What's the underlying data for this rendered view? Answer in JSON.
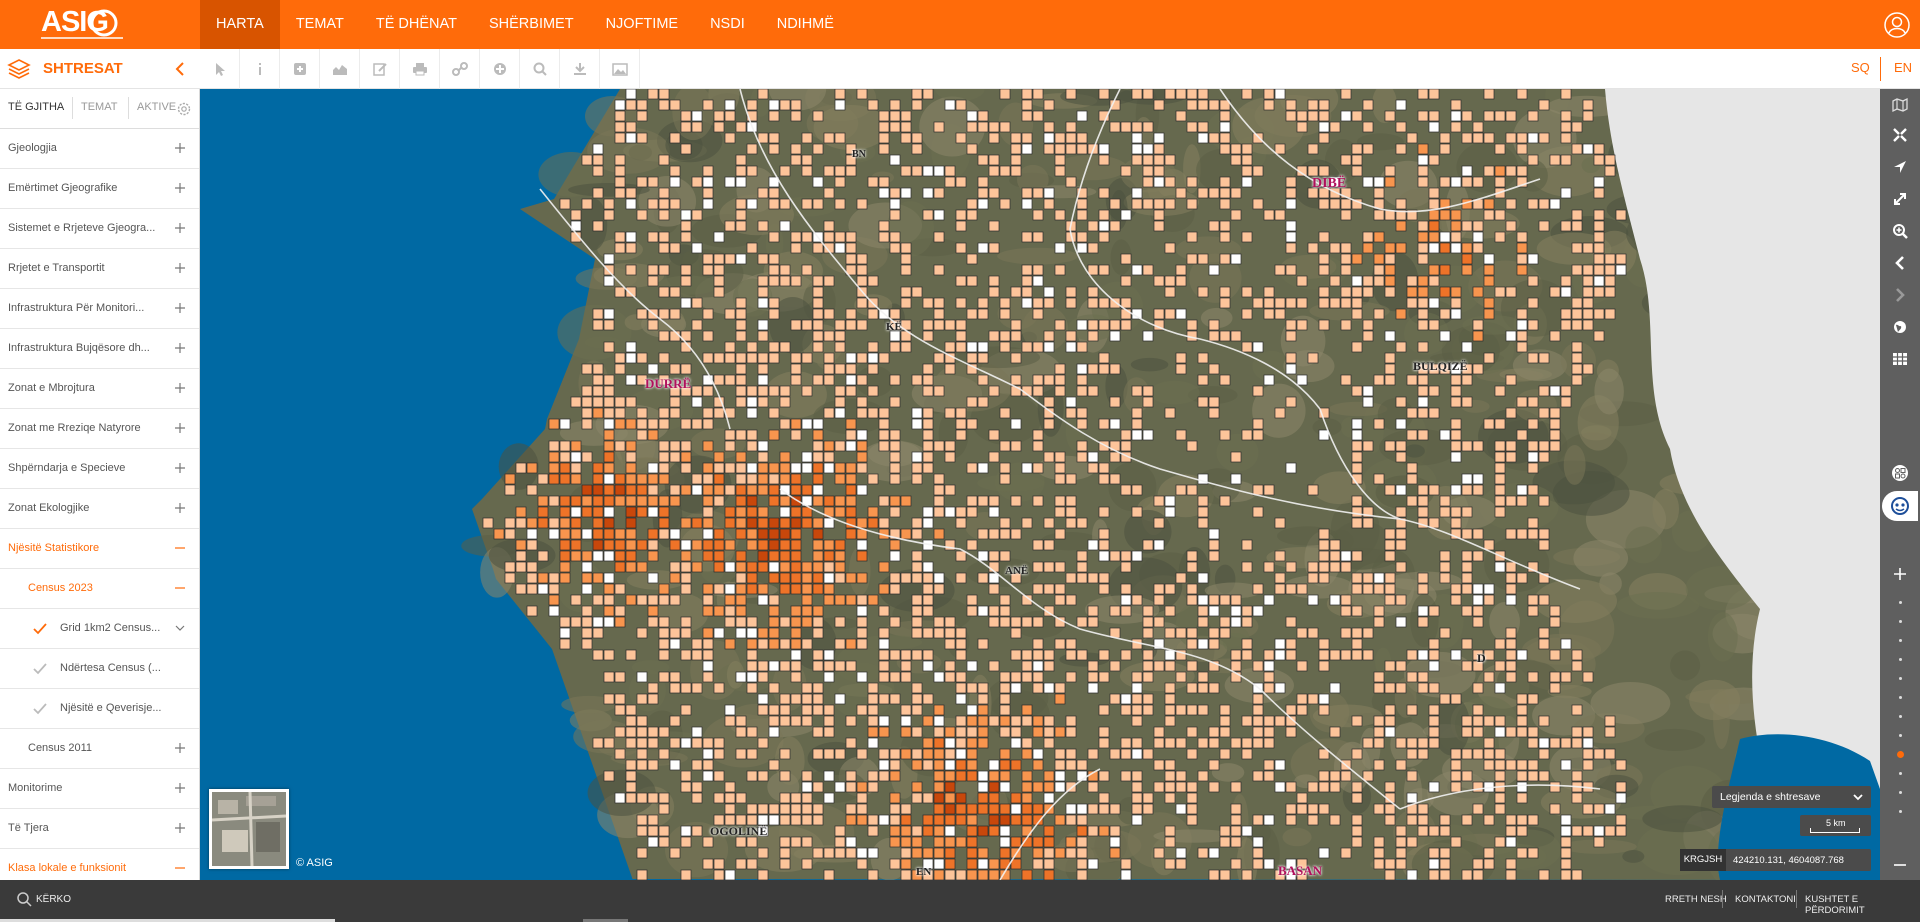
{
  "header": {
    "logo_text": "ASIG",
    "nav": [
      {
        "label": "HARTA",
        "active": true
      },
      {
        "label": "TEMAT"
      },
      {
        "label": "TË DHËNAT"
      },
      {
        "label": "SHËRBIMET"
      },
      {
        "label": "NJOFTIME"
      },
      {
        "label": "NSDI"
      },
      {
        "label": "NDIHMË"
      }
    ],
    "user_icon": "user-icon"
  },
  "layers_panel": {
    "title": "SHTRESAT",
    "tabs": [
      "TË GJITHA",
      "TEMAT",
      "AKTIVE"
    ],
    "rows": [
      {
        "label": "Gjeologjia",
        "state": "plus"
      },
      {
        "label": "Emërtimet Gjeografike",
        "state": "plus"
      },
      {
        "label": "Sistemet e Rrjeteve Gjeogra...",
        "state": "plus"
      },
      {
        "label": "Rrjetet e Transportit",
        "state": "plus"
      },
      {
        "label": "Infrastruktura Për Monitori...",
        "state": "plus"
      },
      {
        "label": "Infrastruktura Bujqësore dh...",
        "state": "plus"
      },
      {
        "label": "Zonat e Mbrojtura",
        "state": "plus"
      },
      {
        "label": "Zonat me Rreziqe Natyrore",
        "state": "plus"
      },
      {
        "label": "Shpërndarja e Specieve",
        "state": "plus"
      },
      {
        "label": "Zonat Ekologjike",
        "state": "plus"
      },
      {
        "label": "Njësitë Statistikore",
        "state": "minus",
        "highlight": true
      },
      {
        "label": "Census 2023",
        "state": "minus",
        "highlight": true,
        "indent": 1
      },
      {
        "label": "Grid 1km2 Census...",
        "state": "chevron",
        "indent": 2,
        "checked": true
      },
      {
        "label": "Ndërtesa Census (...",
        "state": "none",
        "indent": 2,
        "checked": "light"
      },
      {
        "label": "Njësitë e Qeverisje...",
        "state": "none",
        "indent": 2,
        "checked": "light"
      },
      {
        "label": "Census 2011",
        "state": "plus",
        "indent": 1
      },
      {
        "label": "Monitorime",
        "state": "plus"
      },
      {
        "label": "Të Tjera",
        "state": "plus"
      },
      {
        "label": "Klasa lokale e funksionit",
        "state": "minus",
        "highlight": true
      }
    ]
  },
  "toolbar": {
    "tools": [
      "pointer-icon",
      "info-icon",
      "add-icon",
      "profile-icon",
      "edit-icon",
      "print-icon",
      "link-icon",
      "target-icon",
      "search-icon",
      "download-icon",
      "image-icon"
    ],
    "languages": [
      "SQ",
      "EN"
    ]
  },
  "map": {
    "places": [
      {
        "label": "DIBË",
        "color": "#b0105c"
      },
      {
        "label": "BULQIZË",
        "color": "#222"
      },
      {
        "label": "DURRË",
        "color": "#b0105c"
      },
      {
        "label": "BASAN",
        "color": "#b0105c"
      },
      {
        "label": "OGOLINË",
        "color": "#222"
      },
      {
        "label": "KË",
        "color": "#222"
      },
      {
        "label": "ANË",
        "color": "#222"
      },
      {
        "label": "D",
        "color": "#222"
      },
      {
        "label": "EN",
        "color": "#222"
      },
      {
        "label": "BN",
        "color": "#222"
      }
    ],
    "copyright": "© ASIG",
    "legend_label": "Legjenda e shtresave",
    "scale_label": "5 km",
    "crs_label": "KRGJSH",
    "coordinates": "424210.131, 4604087.768"
  },
  "right_rail": {
    "buttons": [
      "basemap-icon",
      "fullscreen-icon",
      "locate-icon",
      "expand-icon",
      "zoom-area-icon",
      "back-icon",
      "forward-icon",
      "globe-icon",
      "grid-icon",
      "shapes-icon",
      "face-icon",
      "zoom-in-icon",
      "zoom-out-icon"
    ],
    "zoom_level": 6
  },
  "footer": {
    "search_label": "KËRKO",
    "links": [
      "RRETH NESH",
      "KONTAKTONI",
      "KUSHTET E PËRDORIMIT"
    ]
  },
  "colors": {
    "brand": "#ff6b0a",
    "brand_dark": "#d85400",
    "sea": "#0069a3",
    "panel_dark": "#4b4b4b"
  }
}
